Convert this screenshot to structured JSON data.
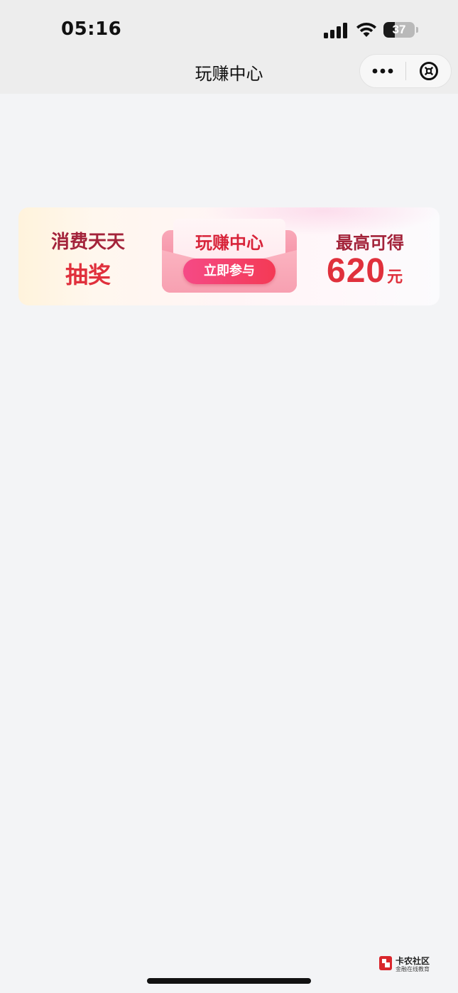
{
  "status_bar": {
    "time": "05:16",
    "battery_level": "37",
    "battery_fraction": 0.37
  },
  "nav": {
    "title": "玩赚中心",
    "more_icon": "more-dots-icon",
    "close_icon": "close-circle-icon"
  },
  "banner": {
    "left_line1": "消费天天",
    "left_line2": "抽奖",
    "center_title": "玩赚中心",
    "button_label": "立即参与",
    "right_line1": "最高可得",
    "amount": "620",
    "unit": "元"
  },
  "watermark": {
    "title": "卡农社区",
    "subtitle": "金融在线教育"
  },
  "colors": {
    "accent_red": "#e0303c",
    "dark_red": "#a3233a",
    "button_pink": "#f54a86",
    "background": "#f3f4f6",
    "nav_background": "#ededed"
  }
}
